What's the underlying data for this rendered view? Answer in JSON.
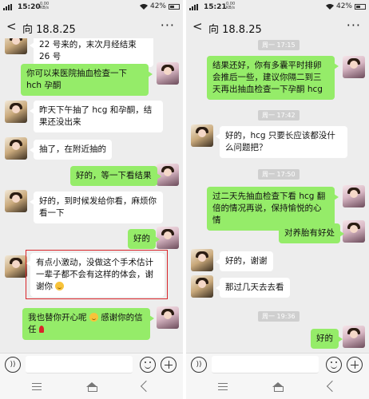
{
  "status_left": {
    "time": "15:20",
    "speed": "0.00\nKB/s",
    "battery": "42%"
  },
  "status_right": {
    "time": "15:21",
    "speed": "0.00\nKB/s",
    "battery": "42%"
  },
  "chat_title_left": "向 18.8.25",
  "chat_title_right": "向 18.8.25",
  "icons": {
    "back": "chevron-left-icon",
    "more": "more-dots-icon",
    "voice": "voice-icon",
    "emoji": "emoji-icon",
    "plus": "plus-icon"
  },
  "colors": {
    "sent_bubble": "#95ec69",
    "received_bubble": "#ffffff",
    "background": "#ededed",
    "highlight": "#d9252a"
  },
  "left_messages": [
    {
      "side": "them",
      "text": "22 号来的，末次月经结束 26 号"
    },
    {
      "side": "me",
      "text": "你可以来医院抽血检查一下 hch 孕酮"
    },
    {
      "side": "them",
      "text": "昨天下午抽了 hcg 和孕酮，结果还没出来"
    },
    {
      "side": "them",
      "text": "抽了，在附近抽的"
    },
    {
      "side": "me",
      "text": "好的，等一下看结果"
    },
    {
      "side": "them",
      "text": "好的，到时候发给你看，麻烦你看一下"
    },
    {
      "side": "me",
      "text": "好的"
    },
    {
      "side": "them",
      "text": "有点小激动，没做这个手术估计一辈子都不会有这样的体会，谢谢你"
    },
    {
      "side": "me",
      "text": "我也替你开心呢",
      "text2": "感谢你的信任"
    }
  ],
  "right_timestamps": [
    "周一 17:15",
    "周一 17:42",
    "周一 17:50",
    "周一 19:36"
  ],
  "right_messages": [
    {
      "side": "me",
      "text": "结果还好，你有多囊平时排卵会推后一些，建议你隔二到三天再出抽血检查一下孕酮 hcg"
    },
    {
      "side": "them",
      "text": "好的，hcg 只要长应该都没什么问题把？"
    },
    {
      "side": "me",
      "text": "过二天先抽血检查下看 hcg 翻倍的情况再说，保持愉悦的心情"
    },
    {
      "side": "me",
      "text": "对养胎有好处"
    },
    {
      "side": "them",
      "text": "好的，谢谢"
    },
    {
      "side": "them",
      "text": "那过几天去去看"
    },
    {
      "side": "me",
      "text": "好的"
    }
  ]
}
